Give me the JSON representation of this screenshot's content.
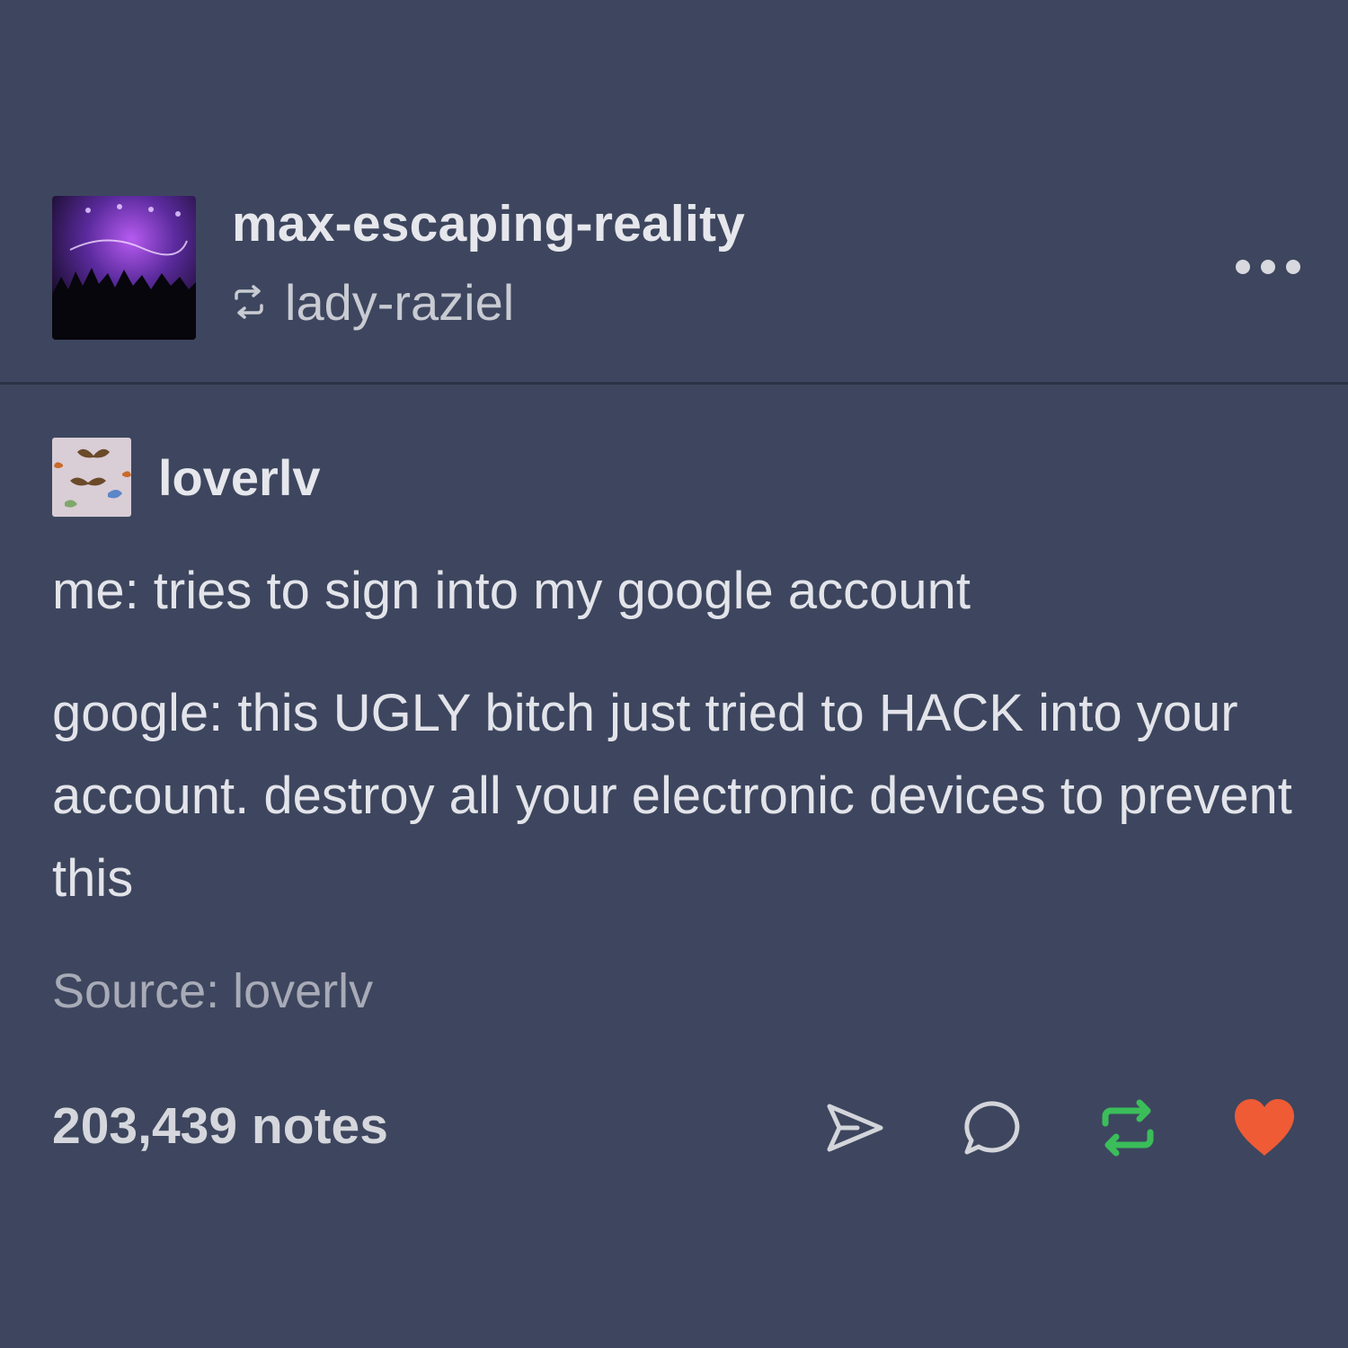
{
  "post": {
    "blog_name": "max-escaping-reality",
    "reblogged_from": "lady-raziel",
    "source_username": "loverlv",
    "body_paragraphs": [
      "me: tries to sign into my google account",
      "google: this UGLY bitch just tried to HACK into your account. destroy all your electronic devices to prevent this"
    ],
    "source_credit": "Source: loverlv",
    "notes_label": "203,439 notes"
  },
  "icons": {
    "reblog_small": "reblog-icon",
    "more": "more-options-icon",
    "share": "paper-plane-send-icon",
    "reply": "speech-bubble-icon",
    "reblog": "reblog-arrows-icon",
    "like": "heart-icon"
  },
  "colors": {
    "background": "#3d465e",
    "reblog_active": "#3bbd5a",
    "like_active": "#ee5b35"
  }
}
